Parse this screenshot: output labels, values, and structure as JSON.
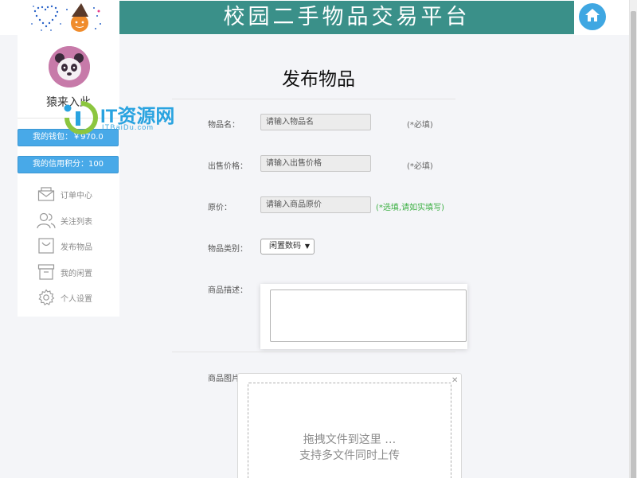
{
  "header": {
    "banner_text": "校园二手物品交易平台",
    "home_icon": "home-icon",
    "banner_color": "#3a9089"
  },
  "sidebar": {
    "username": "猿来入此",
    "wallet_label": "我的钱包：￥970.0",
    "credit_label": "我的信用积分：100",
    "items": [
      {
        "label": "订单中心",
        "icon": "envelope-icon"
      },
      {
        "label": "关注列表",
        "icon": "users-icon"
      },
      {
        "label": "发布物品",
        "icon": "shopping-bag-icon"
      },
      {
        "label": "我的闲置",
        "icon": "archive-box-icon"
      },
      {
        "label": "个人设置",
        "icon": "gear-icon"
      }
    ]
  },
  "watermark": {
    "text": "IT资源网",
    "sub": "ITBaiDu.com"
  },
  "form": {
    "title": "发布物品",
    "name": {
      "label": "物品名：",
      "placeholder": "请输入物品名",
      "hint": "(*必填)"
    },
    "price": {
      "label": "出售价格：",
      "placeholder": "请输入出售价格",
      "hint": "(*必填)"
    },
    "original_price": {
      "label": "原价：",
      "placeholder": "请输入商品原价",
      "hint": "(*选填,请如实填写)"
    },
    "category": {
      "label": "物品类别：",
      "selected": "闲置数码"
    },
    "description": {
      "label": "商品描述："
    },
    "images": {
      "label": "商品图片：",
      "drop_line1": "拖拽文件到这里 …",
      "drop_line2": "支持多文件同时上传"
    }
  }
}
